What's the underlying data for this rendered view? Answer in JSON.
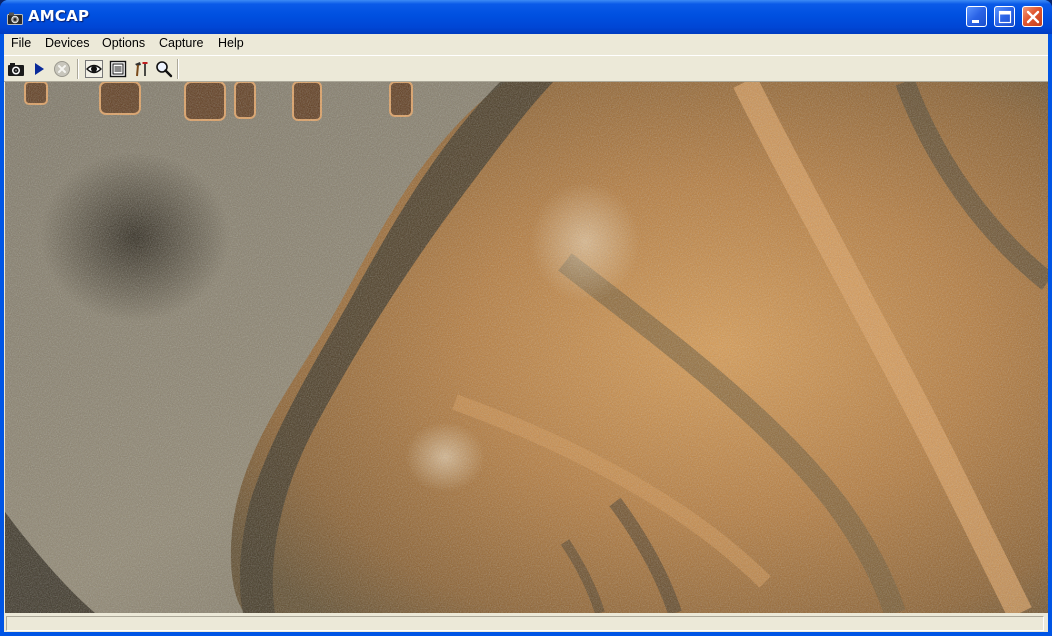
{
  "window": {
    "title": "AMCAP",
    "controls": {
      "minimize_icon": "minimize-icon",
      "maximize_icon": "maximize-icon",
      "close_icon": "close-icon"
    }
  },
  "menubar": {
    "items": [
      {
        "label": "File"
      },
      {
        "label": "Devices"
      },
      {
        "label": "Options"
      },
      {
        "label": "Capture"
      },
      {
        "label": "Help"
      }
    ]
  },
  "toolbar": {
    "buttons": [
      {
        "icon": "camera-icon",
        "enabled": true
      },
      {
        "icon": "play-icon",
        "enabled": true
      },
      {
        "icon": "stop-icon",
        "enabled": false
      },
      {
        "icon": "preview-eye-icon",
        "enabled": true
      },
      {
        "icon": "properties-icon",
        "enabled": true
      },
      {
        "icon": "settings-tools-icon",
        "enabled": true
      },
      {
        "icon": "zoom-icon",
        "enabled": true
      }
    ]
  },
  "preview": {
    "content": "video-preview",
    "colors": {
      "dark": "#4a4030",
      "copper": "#c08040",
      "light": "#e0b070",
      "gray": "#8a8470"
    }
  },
  "statusbar": {
    "text": ""
  },
  "colors": {
    "titlebar_blue": "#0050e0",
    "chrome": "#ece9d8",
    "close_red": "#e0552f"
  }
}
